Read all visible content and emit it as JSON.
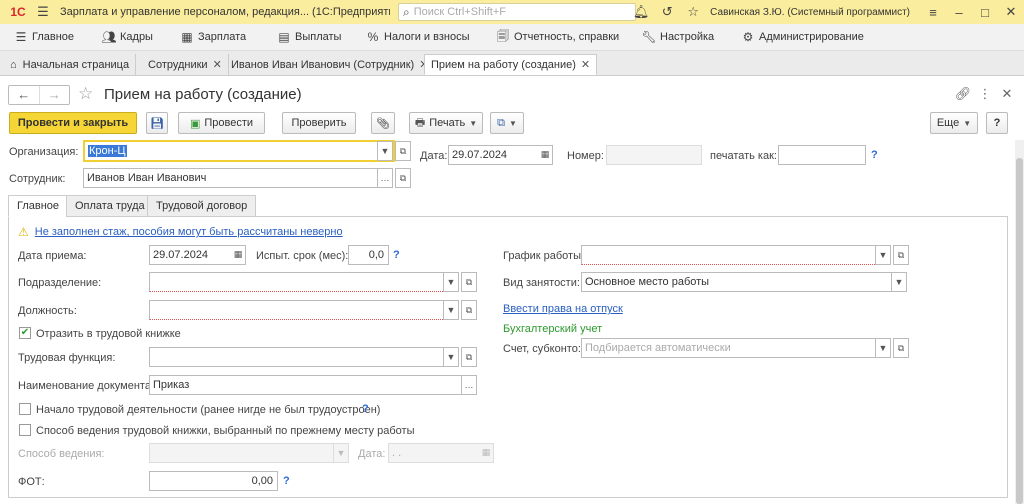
{
  "titlebar": {
    "logo": "1С",
    "app_title": "Зарплата и управление персоналом, редакция... (1С:Предприятие)",
    "search_placeholder": "Поиск Ctrl+Shift+F",
    "user": "Савинская З.Ю. (Системный программист)"
  },
  "menu": {
    "items": [
      {
        "label": "Главное",
        "icon": "hamburger-icon"
      },
      {
        "label": "Кадры",
        "icon": "people-icon"
      },
      {
        "label": "Зарплата",
        "icon": "calculator-icon"
      },
      {
        "label": "Выплаты",
        "icon": "wallet-icon"
      },
      {
        "label": "Налоги и взносы",
        "icon": "percent-icon"
      },
      {
        "label": "Отчетность, справки",
        "icon": "document-icon"
      },
      {
        "label": "Настройка",
        "icon": "wrench-icon"
      },
      {
        "label": "Администрирование",
        "icon": "gear-icon"
      }
    ]
  },
  "tabs": [
    {
      "label": "Начальная страница"
    },
    {
      "label": "Сотрудники"
    },
    {
      "label": "Иванов Иван Иванович (Сотрудник)"
    },
    {
      "label": "Прием на работу (создание)"
    }
  ],
  "form": {
    "title": "Прием на работу (создание)",
    "toolbar": {
      "post_close": "Провести и закрыть",
      "post": "Провести",
      "check": "Проверить",
      "print": "Печать",
      "more": "Еще",
      "help": "?"
    },
    "organization": {
      "label": "Организация:",
      "value": "Крон-Ц"
    },
    "date": {
      "label": "Дата:",
      "value": "29.07.2024"
    },
    "number": {
      "label": "Номер:",
      "value": ""
    },
    "print_as": {
      "label": "печатать как:",
      "value": ""
    },
    "employee": {
      "label": "Сотрудник:",
      "value": "Иванов Иван Иванович"
    }
  },
  "inner_tabs": [
    {
      "label": "Главное"
    },
    {
      "label": "Оплата труда"
    },
    {
      "label": "Трудовой договор"
    }
  ],
  "main": {
    "warning": "Не заполнен стаж, пособия могут быть рассчитаны неверно",
    "hire_date": {
      "label": "Дата приема:",
      "value": "29.07.2024"
    },
    "probation": {
      "label": "Испыт. срок (мес):",
      "value": "0,0"
    },
    "department": {
      "label": "Подразделение:",
      "value": ""
    },
    "position": {
      "label": "Должность:",
      "value": ""
    },
    "reflect_workbook": {
      "label": "Отразить в трудовой книжке",
      "checked": true
    },
    "labor_function": {
      "label": "Трудовая функция:",
      "value": ""
    },
    "doc_name": {
      "label": "Наименование документа:",
      "value": "Приказ"
    },
    "career_start": {
      "label": "Начало трудовой деятельности (ранее нигде не был трудоустроен)",
      "checked": false
    },
    "workbook_method_prev": {
      "label": "Способ ведения трудовой книжки, выбранный по прежнему месту работы",
      "checked": false
    },
    "method": {
      "label": "Способ ведения:",
      "value": ""
    },
    "method_date": {
      "label": "Дата:",
      "value": " .  .    "
    },
    "fot": {
      "label": "ФОТ:",
      "value": "0,00"
    },
    "schedule": {
      "label": "График работы:",
      "value": ""
    },
    "employment_type": {
      "label": "Вид занятости:",
      "value": "Основное место работы"
    },
    "vacation_link": "Ввести права на отпуск",
    "accounting_header": "Бухгалтерский учет",
    "account": {
      "label": "Счет, субконто:",
      "placeholder": "Подбирается автоматически"
    }
  },
  "colors": {
    "titlebar_bg": "#fbed9e",
    "primary_button": "#f5d636",
    "link": "#2a5fc0",
    "accounting_header": "#2e9a2e",
    "required_underline": "#e05050"
  }
}
